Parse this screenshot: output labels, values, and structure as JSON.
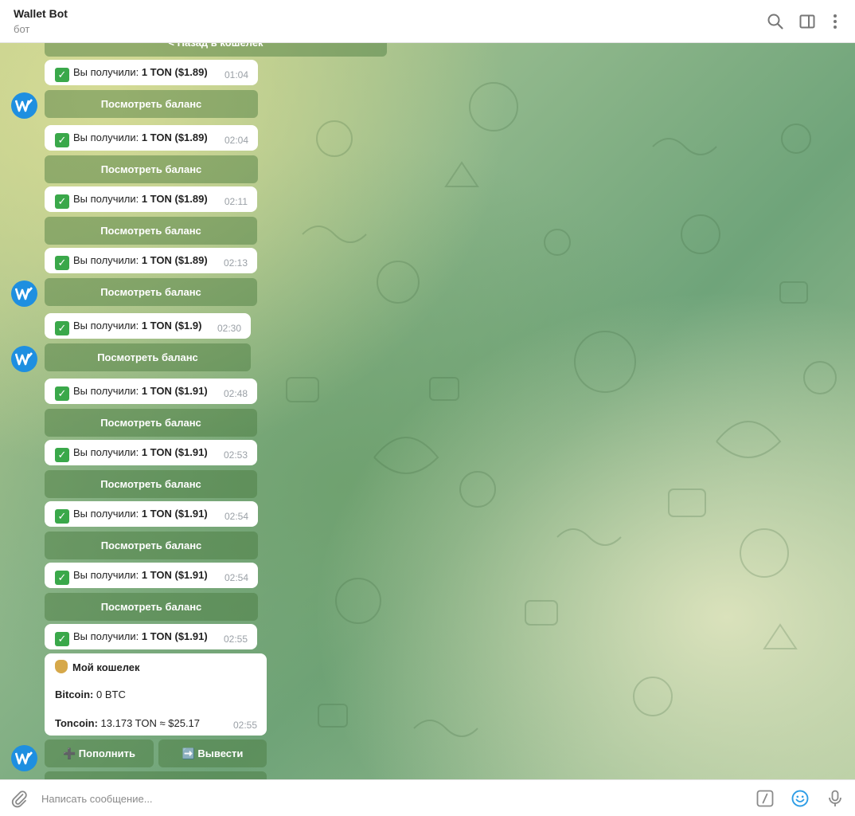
{
  "header": {
    "title": "Wallet Bot",
    "subtitle": "бот",
    "icons": [
      "search-icon",
      "sidebar-toggle-icon",
      "more-vertical-icon"
    ]
  },
  "colors": {
    "avatar_bg": "#1e8fe0",
    "check_green": "#3aa84a"
  },
  "messages": {
    "back_button": "< Назад в кошелек",
    "received_label": "Вы получили:",
    "view_balance_label": "Посмотреть баланс",
    "items": [
      {
        "amount": "1 TON ($1.89)",
        "time": "01:04"
      },
      {
        "amount": "1 TON ($1.89)",
        "time": "02:04"
      },
      {
        "amount": "1 TON ($1.89)",
        "time": "02:11"
      },
      {
        "amount": "1 TON ($1.89)",
        "time": "02:13"
      },
      {
        "amount": "1 TON ($1.9)",
        "time": "02:30"
      },
      {
        "amount": "1 TON ($1.91)",
        "time": "02:48"
      },
      {
        "amount": "1 TON ($1.91)",
        "time": "02:53"
      },
      {
        "amount": "1 TON ($1.91)",
        "time": "02:54"
      },
      {
        "amount": "1 TON ($1.91)",
        "time": "02:54"
      },
      {
        "amount": "1 TON ($1.91)",
        "time": "02:55"
      }
    ]
  },
  "wallet": {
    "title": "Мой кошелек",
    "bitcoin_label": "Bitcoin:",
    "bitcoin_value": "0 BTC",
    "toncoin_label": "Toncoin:",
    "toncoin_value": "13.173 TON ≈ $25.17",
    "time": "02:55",
    "deposit_button": "➕ Пополнить",
    "withdraw_button": "➡️ Вывести"
  },
  "composer": {
    "placeholder": "Написать сообщение...",
    "icons": [
      "attach-icon",
      "bot-commands-icon",
      "emoji-icon",
      "microphone-icon"
    ]
  }
}
